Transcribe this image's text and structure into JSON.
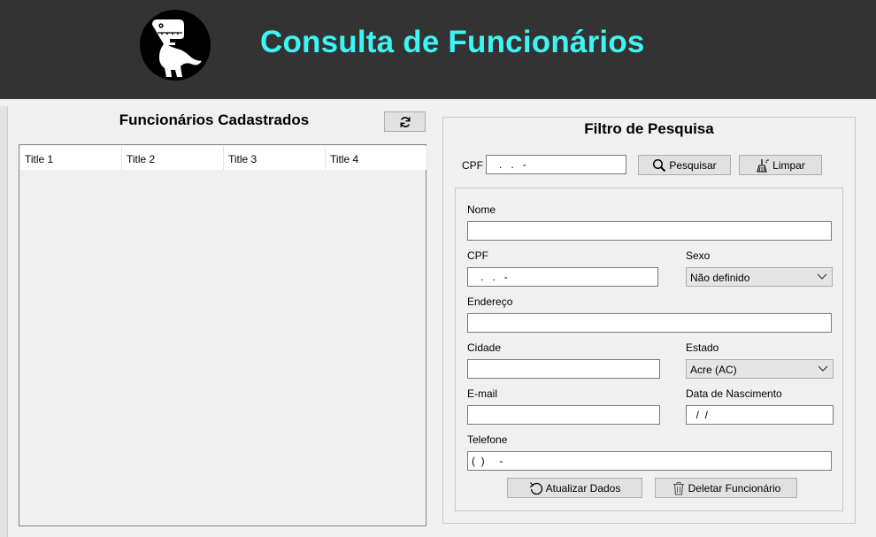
{
  "header": {
    "title": "Consulta de Funcionários",
    "title_color": "#3df5f5",
    "background": "#333333",
    "logo_icon": "dinosaur-logo-icon"
  },
  "list_panel": {
    "title": "Funcionários Cadastrados",
    "refresh_icon": "refresh-icon",
    "columns": [
      "Title 1",
      "Title 2",
      "Title 3",
      "Title 4"
    ],
    "rows": []
  },
  "filter": {
    "title": "Filtro de Pesquisa",
    "cpf_label": "CPF",
    "cpf_value": "   .   .   -",
    "search_button": "Pesquisar",
    "clear_button": "Limpar"
  },
  "form": {
    "nome_label": "Nome",
    "nome_value": "",
    "cpf_label": "CPF",
    "cpf_value": "   .   .   -",
    "sexo_label": "Sexo",
    "sexo_value": "Não definido",
    "endereco_label": "Endereço",
    "endereco_value": "",
    "cidade_label": "Cidade",
    "cidade_value": "",
    "estado_label": "Estado",
    "estado_value": "Acre (AC)",
    "email_label": "E-mail",
    "email_value": "",
    "nascimento_label": "Data de Nascimento",
    "nascimento_value": "  /  /",
    "telefone_label": "Telefone",
    "telefone_value": "(  )     -",
    "update_button": "Atualizar Dados",
    "delete_button": "Deletar Funcionário"
  }
}
